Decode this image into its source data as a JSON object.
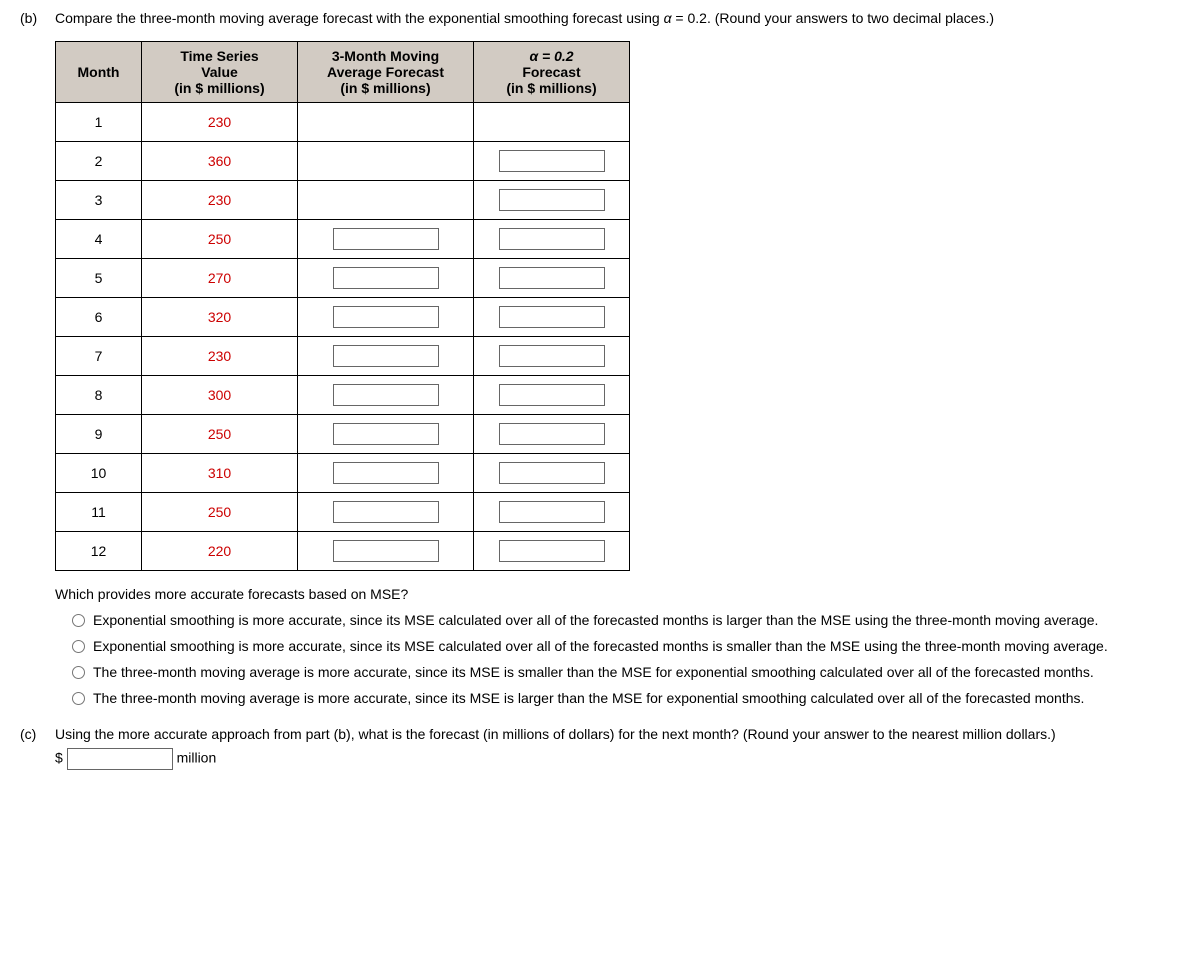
{
  "partB": {
    "label": "(b)",
    "prompt_prefix": "Compare the three-month moving average forecast with the exponential smoothing forecast using ",
    "alpha_text": "α",
    "alpha_eq": " = 0.2. (Round your answers to two decimal places.)",
    "headers": {
      "month": "Month",
      "ts1": "Time Series",
      "ts2": "Value",
      "ts3": "(in $ millions)",
      "ma1": "3-Month Moving",
      "ma2": "Average Forecast",
      "ma3": "(in $ millions)",
      "al1": "α = 0.2",
      "al2": "Forecast",
      "al3": "(in $ millions)"
    },
    "rows": [
      {
        "month": "1",
        "value": "230",
        "ma_input": false,
        "alpha_input": false
      },
      {
        "month": "2",
        "value": "360",
        "ma_input": false,
        "alpha_input": true
      },
      {
        "month": "3",
        "value": "230",
        "ma_input": false,
        "alpha_input": true
      },
      {
        "month": "4",
        "value": "250",
        "ma_input": true,
        "alpha_input": true
      },
      {
        "month": "5",
        "value": "270",
        "ma_input": true,
        "alpha_input": true
      },
      {
        "month": "6",
        "value": "320",
        "ma_input": true,
        "alpha_input": true
      },
      {
        "month": "7",
        "value": "230",
        "ma_input": true,
        "alpha_input": true
      },
      {
        "month": "8",
        "value": "300",
        "ma_input": true,
        "alpha_input": true
      },
      {
        "month": "9",
        "value": "250",
        "ma_input": true,
        "alpha_input": true
      },
      {
        "month": "10",
        "value": "310",
        "ma_input": true,
        "alpha_input": true
      },
      {
        "month": "11",
        "value": "250",
        "ma_input": true,
        "alpha_input": true
      },
      {
        "month": "12",
        "value": "220",
        "ma_input": true,
        "alpha_input": true
      }
    ],
    "mse_question": "Which provides more accurate forecasts based on MSE?",
    "options": [
      "Exponential smoothing is more accurate, since its MSE calculated over all of the forecasted months is larger than the MSE using the three-month moving average.",
      "Exponential smoothing is more accurate, since its MSE calculated over all of the forecasted months is smaller than the MSE using the three-month moving average.",
      "The three-month moving average is more accurate, since its MSE is smaller than the MSE for exponential smoothing calculated over all of the forecasted months.",
      "The three-month moving average is more accurate, since its MSE is larger than the MSE for exponential smoothing calculated over all of the forecasted months."
    ]
  },
  "partC": {
    "label": "(c)",
    "prompt": "Using the more accurate approach from part (b), what is the forecast (in millions of dollars) for the next month? (Round your answer to the nearest million dollars.)",
    "dollar": "$",
    "unit": "million"
  }
}
